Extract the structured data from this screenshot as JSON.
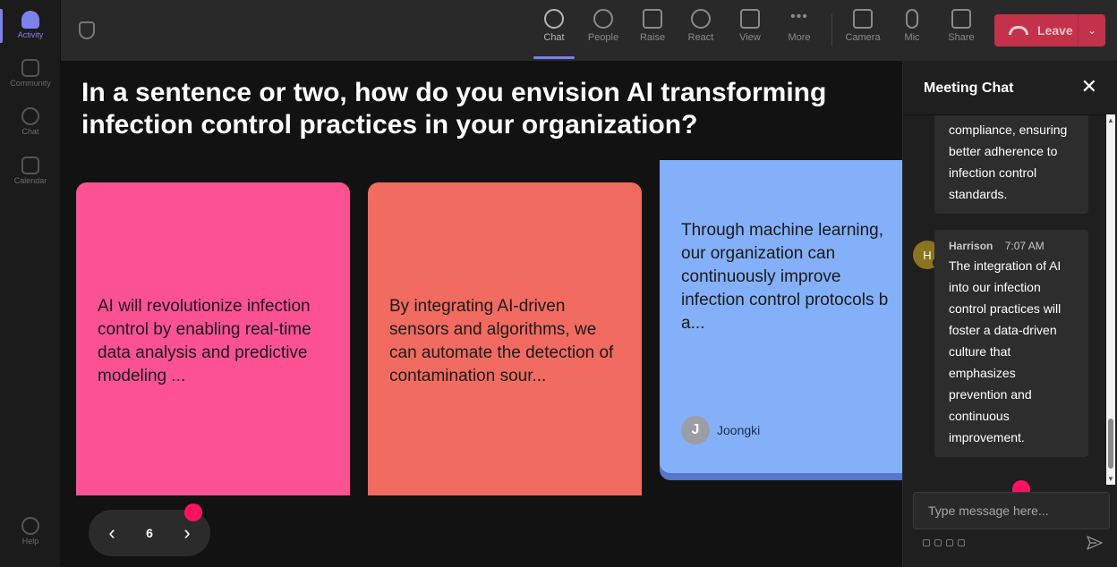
{
  "rail": {
    "items": [
      {
        "label": "Activity"
      },
      {
        "label": "Community"
      },
      {
        "label": "Chat"
      },
      {
        "label": "Calendar"
      },
      {
        "label": "Help"
      }
    ]
  },
  "toolbar": {
    "chat": "Chat",
    "people": "People",
    "raise": "Raise",
    "react": "React",
    "view": "View",
    "more": "More",
    "camera": "Camera",
    "mic": "Mic",
    "share": "Share",
    "leave": "Leave"
  },
  "stage": {
    "question": "In a sentence or two, how do you envision AI transforming infection control practices in your organization?",
    "cards": [
      {
        "text": "AI will revolutionize infection control by enabling real-time data analysis and predictive modeling ...",
        "color": "#fc5193"
      },
      {
        "text": "By integrating AI-driven sensors and algorithms, we can automate the detection of contamination sour...",
        "color": "#f16b60"
      },
      {
        "lines": [
          "Through machine learning,",
          "our organization can",
          "continuously improve",
          "infection control protocols b",
          "a..."
        ],
        "author": "Joongki",
        "author_initial": "J",
        "color": "#84b0f9"
      }
    ],
    "pager": {
      "page": "6"
    }
  },
  "chat": {
    "title": "Meeting Chat",
    "messages": [
      {
        "lines": [
          "compliance, ensuring",
          "better adherence to",
          "infection control",
          "standards."
        ]
      },
      {
        "sender": "Harrison",
        "initial": "H",
        "time": "7:07 AM",
        "lines": [
          "The integration of AI",
          "into our infection",
          "control practices will",
          "foster a data-driven",
          "culture that",
          "emphasizes",
          "prevention and",
          "continuous",
          "improvement."
        ]
      }
    ],
    "input_placeholder": "Type message here..."
  },
  "colors": {
    "accent": "#7b83eb",
    "leave": "#c4314b",
    "highlight_dot": "#ff1163"
  }
}
